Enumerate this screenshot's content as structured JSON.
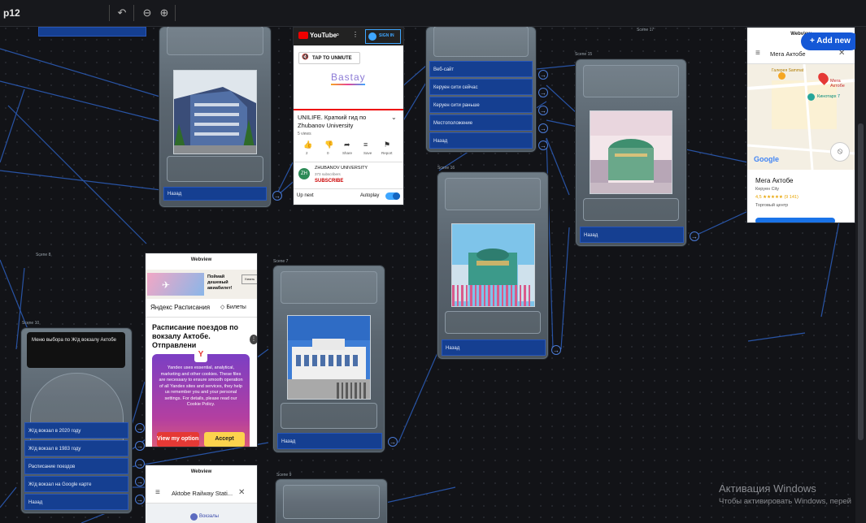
{
  "app": {
    "title": "p12"
  },
  "toolbar": {
    "undo_icon": "undo-icon",
    "zoom_out_icon": "zoom-out-icon",
    "zoom_in_icon": "zoom-in-icon"
  },
  "add_new": "+ Add new",
  "common": {
    "back": "Назад",
    "webview": "Webview",
    "arrow": "→"
  },
  "scenes": {
    "s17": "Scene 17",
    "s15": "Scene 15",
    "s16": "Scene 16",
    "s8": "Scene 8",
    "s10": "Scene 10",
    "s7": "Scene 7",
    "s9": "Scene 9"
  },
  "scene_top_buttons": [
    "Веб-сайт",
    "Керуен сити сейчас",
    "Керуен сити раньше",
    "Местоположение",
    "Назад"
  ],
  "youtube": {
    "logo": "YouTube",
    "signin": "SIGN IN",
    "unmute": "TAP TO UNMUTE",
    "brand": "Bastay",
    "title": "UNILIFE. Краткий гид по Zhubanov University",
    "views": "5 views",
    "actions": [
      "2",
      "0",
      "Share",
      "Save",
      "Report"
    ],
    "channel": "ZHUBANOV UNIVERSITY",
    "subs": "373 subscribers",
    "subscribe": "SUBSCRIBE",
    "upnext": "Up next",
    "autoplay": "Autoplay"
  },
  "map_top": {
    "search": "Мега Актобе",
    "pin_label": "Мега Актобе",
    "cinema": "Кинотарх 7",
    "google": "Google",
    "place": "Мега Актобе",
    "area": "Керуен Сity",
    "rating": "4,5 ★★★★★ (9 141)",
    "category": "Торговый центр",
    "poi_top": "Галерея Sammat"
  },
  "rasp": {
    "header": "Webview",
    "ad_text": "Поймай дешевый авиабилет!",
    "ad_button": "Узнать",
    "logo": "Яндекс Расписания",
    "tickets": "Билеты",
    "title": "Расписание поездов по вокзалу Актобе. Отправлени",
    "cookie_text": "Yandex uses essential, analytical, marketing and other cookies. These files are necessary to ensure smooth operation of all Yandex sites and services, they help us remember you and your personal settings. For details, please read our Cookie Policy.",
    "view_my": "View my options",
    "accept": "Accept"
  },
  "scene10": {
    "text": "Меню выбора по Ж/д вокзалу Актобе",
    "buttons": [
      "Ж/д вокзал в 2020 году",
      "Ж/д вокзал в 1983 году",
      "Расписание поездов",
      "Ж/д вокзал на Google карте",
      "Назад"
    ]
  },
  "map_bottom": {
    "header": "Webview",
    "search": "Aktobe Railway Stati...",
    "poi": "Вокзалы"
  },
  "watermark": {
    "line1": "Активация Windows",
    "line2": "Чтобы активировать Windows, перей"
  },
  "colors": {
    "accent": "#1558d6",
    "button": "#153f91",
    "edge": "#2d5fbd"
  }
}
